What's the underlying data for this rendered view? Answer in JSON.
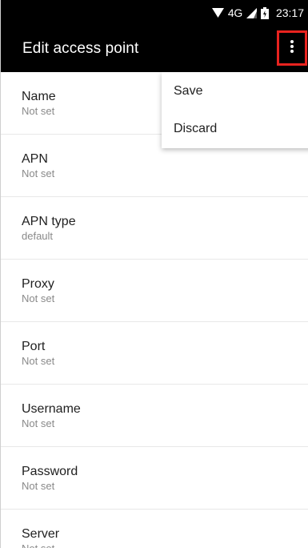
{
  "status_bar": {
    "network": "4G",
    "time": "23:17",
    "icons": [
      "wifi-icon",
      "signal-icon",
      "battery-icon"
    ]
  },
  "app_bar": {
    "title": "Edit access point",
    "overflow_icon": "more-vert-icon",
    "highlight_color": "#e8231f"
  },
  "menu": {
    "items": [
      {
        "label": "Save"
      },
      {
        "label": "Discard"
      }
    ]
  },
  "settings": {
    "items": [
      {
        "title": "Name",
        "summary": "Not set"
      },
      {
        "title": "APN",
        "summary": "Not set"
      },
      {
        "title": "APN type",
        "summary": "default"
      },
      {
        "title": "Proxy",
        "summary": "Not set"
      },
      {
        "title": "Port",
        "summary": "Not set"
      },
      {
        "title": "Username",
        "summary": "Not set"
      },
      {
        "title": "Password",
        "summary": "Not set"
      },
      {
        "title": "Server",
        "summary": "Not set"
      }
    ]
  }
}
